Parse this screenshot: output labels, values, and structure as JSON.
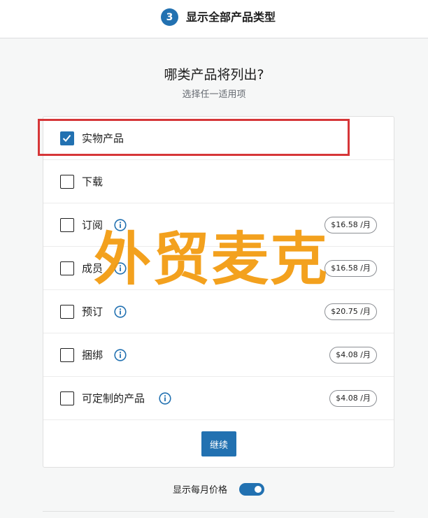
{
  "header": {
    "step_number": "3",
    "step_title": "显示全部产品类型"
  },
  "main": {
    "question": "哪类产品将列出?",
    "hint": "选择任一适用项"
  },
  "product_types": [
    {
      "label": "实物产品",
      "checked": true,
      "info": false,
      "price": ""
    },
    {
      "label": "下载",
      "checked": false,
      "info": false,
      "price": ""
    },
    {
      "label": "订阅",
      "checked": false,
      "info": true,
      "price": "$16.58 /月"
    },
    {
      "label": "成员",
      "checked": false,
      "info": true,
      "price": "$16.58 /月"
    },
    {
      "label": "预订",
      "checked": false,
      "info": true,
      "price": "$20.75 /月"
    },
    {
      "label": "捆绑",
      "checked": false,
      "info": true,
      "price": "$4.08 /月"
    },
    {
      "label": "可定制的产品",
      "checked": false,
      "info": true,
      "price": "$4.08 /月"
    }
  ],
  "continue_label": "继续",
  "monthly_toggle": {
    "label": "显示每月价格",
    "on": true
  },
  "watermark": "外贸麦克",
  "colors": {
    "accent": "#2271b1",
    "highlight": "#d63638",
    "watermark": "#f39c12"
  }
}
